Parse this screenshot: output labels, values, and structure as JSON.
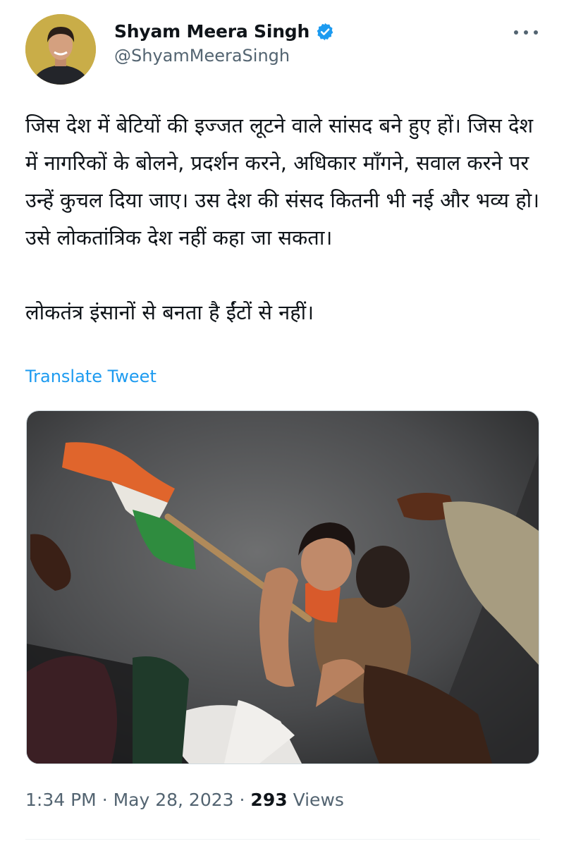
{
  "author": {
    "display_name": "Shyam Meera Singh",
    "handle": "@ShyamMeeraSingh",
    "verified_icon": "verified-badge-icon",
    "verified_color": "#1d9bf0"
  },
  "tweet": {
    "paragraph_1": "जिस देश में बेटियों की इज्जत लूटने वाले सांसद बने हुए हों। जिस देश में नागरिकों के बोलने, प्रदर्शन करने, अधिकार माँगने, सवाल करने पर उन्हें कुचल दिया जाए। उस देश की संसद कितनी भी नई और भव्य हो। उसे लोकतांत्रिक देश नहीं कहा जा सकता।",
    "paragraph_2": "लोकतंत्र इंसानों से बनता है ईंटों से नहीं।",
    "translate_label": "Translate Tweet"
  },
  "meta": {
    "time": "1:34 PM",
    "separator": "·",
    "date": "May 28, 2023",
    "views_count": "293",
    "views_label": "Views"
  },
  "colors": {
    "link": "#1d9bf0",
    "secondary_text": "#536471",
    "primary_text": "#0f1419"
  }
}
